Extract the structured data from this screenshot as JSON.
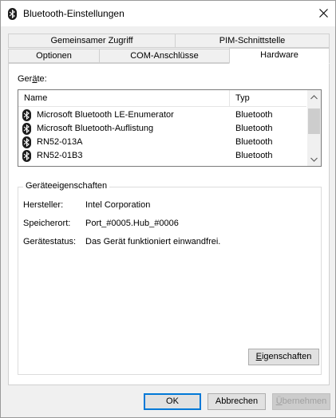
{
  "window": {
    "title": "Bluetooth-Einstellungen"
  },
  "tabs": {
    "row_back": [
      {
        "label": "Gemeinsamer Zugriff"
      },
      {
        "label": "PIM-Schnittstelle"
      }
    ],
    "row_front": [
      {
        "label": "Optionen"
      },
      {
        "label": "COM-Anschlüsse"
      },
      {
        "label": "Hardware",
        "active": true
      }
    ]
  },
  "devices": {
    "label_prefix": "Ger",
    "label_accel": "ä",
    "label_suffix": "te:",
    "columns": {
      "name": "Name",
      "type": "Typ"
    },
    "rows": [
      {
        "name": "Microsoft Bluetooth LE-Enumerator",
        "type": "Bluetooth"
      },
      {
        "name": "Microsoft Bluetooth-Auflistung",
        "type": "Bluetooth"
      },
      {
        "name": "RN52-013A",
        "type": "Bluetooth"
      },
      {
        "name": "RN52-01B3",
        "type": "Bluetooth"
      }
    ]
  },
  "properties": {
    "title": "Geräteeigenschaften",
    "manufacturer_label": "Hersteller:",
    "manufacturer": "Intel Corporation",
    "location_label": "Speicherort:",
    "location": "Port_#0005.Hub_#0006",
    "status_label": "Gerätestatus:",
    "status": "Das Gerät funktioniert einwandfrei.",
    "button_accel": "E",
    "button_rest": "igenschaften"
  },
  "buttons": {
    "ok": "OK",
    "cancel": "Abbrechen",
    "apply_accel": "Ü",
    "apply_rest": "bernehmen"
  },
  "icons": {
    "bluetooth": "bluetooth-icon",
    "close": "close-icon",
    "scroll_up": "chevron-up-icon",
    "scroll_down": "chevron-down-icon"
  },
  "colors": {
    "accent": "#0078d7",
    "window_bg": "#f0f0f0",
    "panel_bg": "#ffffff"
  }
}
